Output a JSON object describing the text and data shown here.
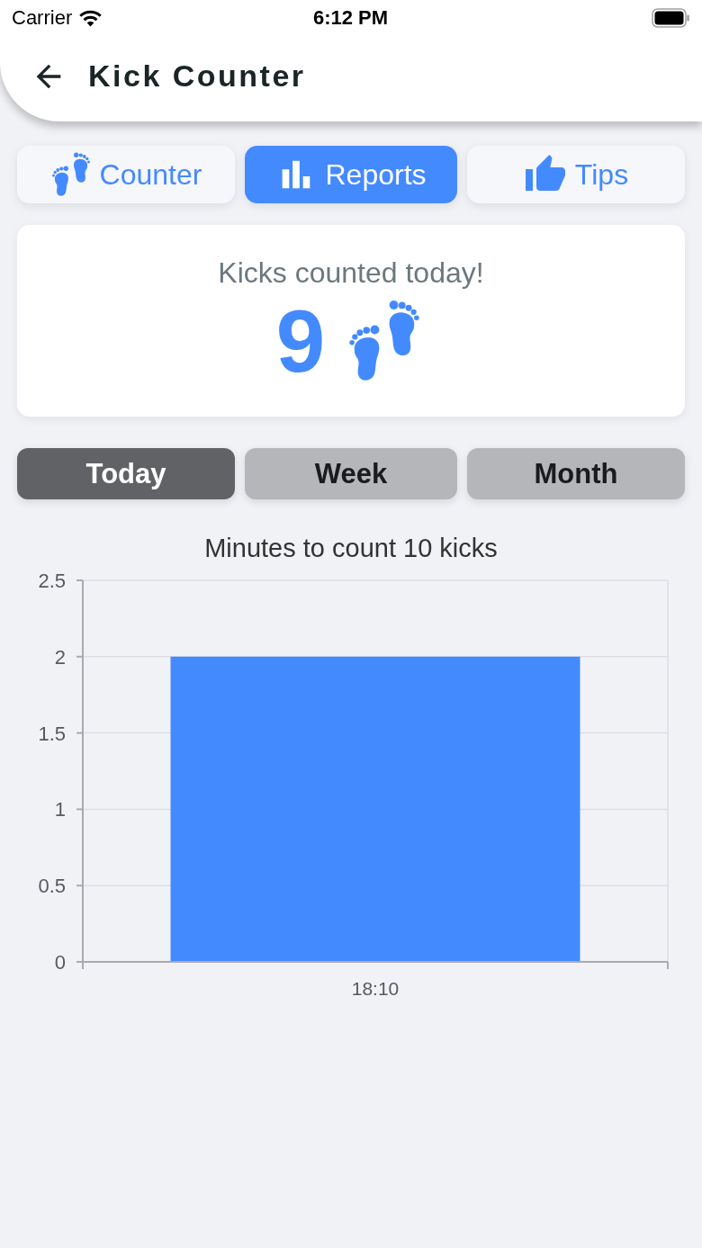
{
  "status_bar": {
    "carrier": "Carrier",
    "time": "6:12 PM"
  },
  "header": {
    "title": "Kick Counter"
  },
  "tabs": [
    {
      "label": "Counter",
      "selected": false
    },
    {
      "label": "Reports",
      "selected": true
    },
    {
      "label": "Tips",
      "selected": false
    }
  ],
  "summary": {
    "caption": "Kicks counted today!",
    "count": "9"
  },
  "periods": [
    {
      "label": "Today",
      "selected": true
    },
    {
      "label": "Week",
      "selected": false
    },
    {
      "label": "Month",
      "selected": false
    }
  ],
  "chart": {
    "chart_data": {
      "type": "bar",
      "title": "Minutes to count 10 kicks",
      "categories": [
        "18:10"
      ],
      "values": [
        2
      ],
      "ylim": [
        0,
        2.5
      ],
      "yticks": [
        0,
        0.5,
        1,
        1.5,
        2,
        2.5
      ],
      "grid": true
    }
  }
}
